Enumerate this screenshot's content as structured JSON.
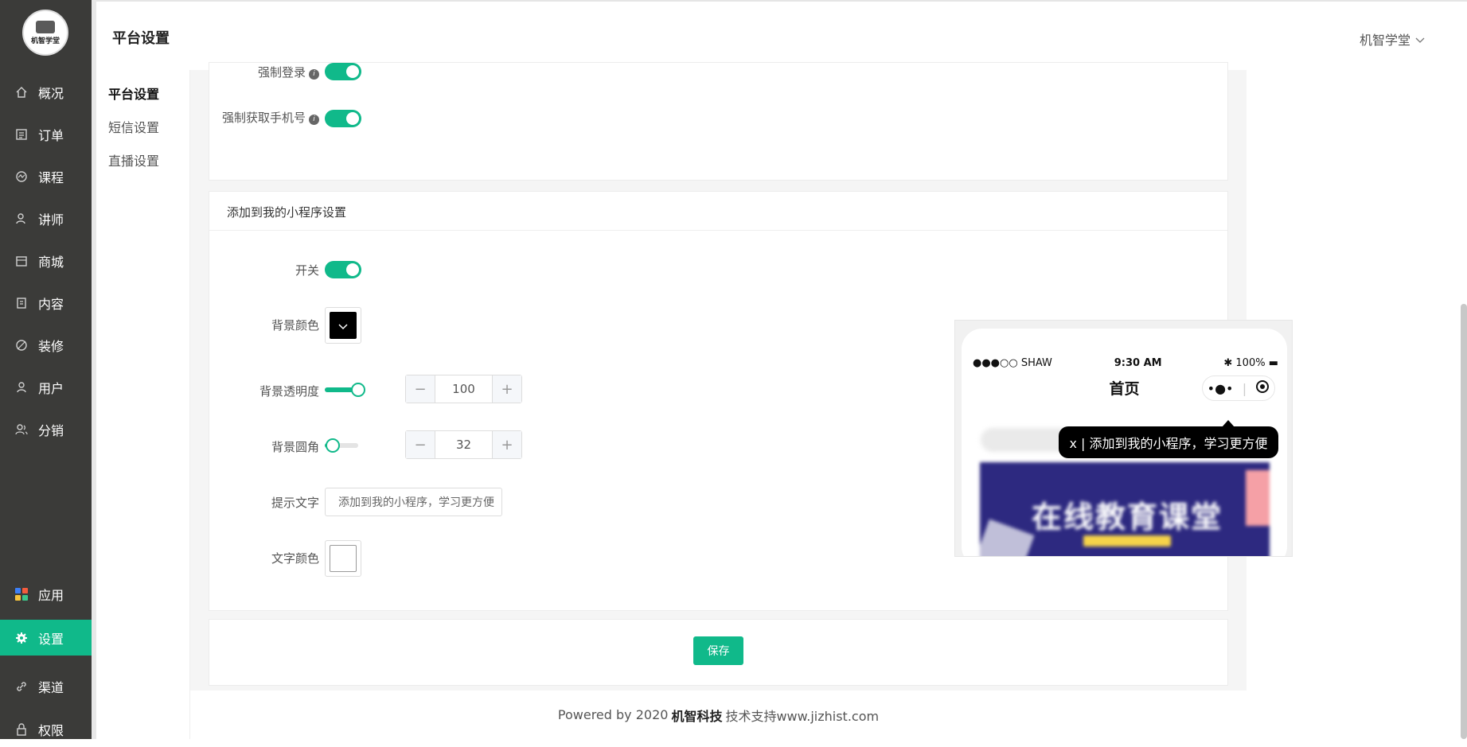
{
  "sidebar": {
    "logo_text": "机智学堂",
    "items": [
      {
        "label": "概况",
        "icon": "home-icon"
      },
      {
        "label": "订单",
        "icon": "order-icon"
      },
      {
        "label": "课程",
        "icon": "course-icon"
      },
      {
        "label": "讲师",
        "icon": "teacher-icon"
      },
      {
        "label": "商城",
        "icon": "store-icon"
      },
      {
        "label": "内容",
        "icon": "content-icon"
      },
      {
        "label": "装修",
        "icon": "decorate-icon"
      },
      {
        "label": "用户",
        "icon": "user-icon"
      },
      {
        "label": "分销",
        "icon": "distribution-icon"
      },
      {
        "label": "应用",
        "icon": "apps-icon"
      },
      {
        "label": "设置",
        "icon": "gear-icon"
      },
      {
        "label": "渠道",
        "icon": "channel-icon"
      },
      {
        "label": "权限",
        "icon": "lock-icon"
      }
    ],
    "active": "设置",
    "accent_color": "#10b98a"
  },
  "header": {
    "title": "平台设置",
    "user_name": "机智学堂"
  },
  "subnav": {
    "items": [
      "平台设置",
      "短信设置",
      "直播设置"
    ]
  },
  "login_card": {
    "force_login_label": "强制登录",
    "force_phone_label": "强制获取手机号"
  },
  "mini_program_card": {
    "title": "添加到我的小程序设置",
    "switch_label": "开关",
    "bg_color_label": "背景颜色",
    "bg_color": "#000000",
    "bg_opacity_label": "背景透明度",
    "bg_opacity_value": "100",
    "bg_radius_label": "背景圆角",
    "bg_radius_value": "32",
    "tip_text_label": "提示文字",
    "tip_text_value": "添加到我的小程序，学习更方便",
    "text_color_label": "文字颜色",
    "text_color": "#ffffff",
    "preview": {
      "carrier": "●●●○○ SHAW",
      "time": "9:30 AM",
      "battery": "100%",
      "page_title": "首页",
      "tip": "x | 添加到我的小程序，学习更方便",
      "banner_text": "在线教育课堂"
    }
  },
  "save_label": "保存",
  "footer": {
    "prefix": "Powered by 2020",
    "brand": "机智科技",
    "suffix": "技术支持www.jizhist.com"
  }
}
